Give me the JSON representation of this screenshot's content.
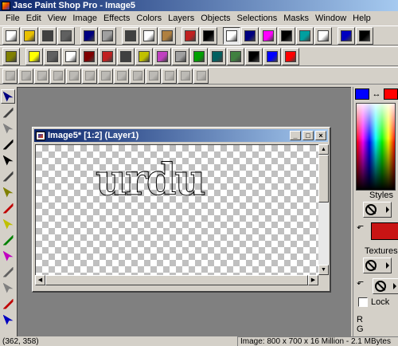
{
  "window": {
    "title": "Jasc Paint Shop Pro - Image5"
  },
  "menu": [
    "File",
    "Edit",
    "View",
    "Image",
    "Effects",
    "Colors",
    "Layers",
    "Objects",
    "Selections",
    "Masks",
    "Window",
    "Help"
  ],
  "toolbar1": [
    {
      "name": "new-icon",
      "color": "#ffffff"
    },
    {
      "name": "open-icon",
      "color": "#e8c000"
    },
    {
      "name": "save-icon",
      "color": "#404040"
    },
    {
      "name": "print-icon",
      "color": "#606060"
    },
    {
      "name": "undo-icon",
      "color": "#000080"
    },
    {
      "name": "redo-icon",
      "color": "#a0a0a0"
    },
    {
      "name": "cut-icon",
      "color": "#404040"
    },
    {
      "name": "copy-icon",
      "color": "#ffffff"
    },
    {
      "name": "paste-icon",
      "color": "#b08040"
    },
    {
      "name": "browse-icon",
      "color": "#c02020"
    },
    {
      "name": "cancel-icon",
      "color": "#000000"
    },
    {
      "name": "zoom-icon",
      "color": "#ffffff"
    },
    {
      "name": "overview-icon",
      "color": "#000080"
    },
    {
      "name": "color-palette-icon",
      "color": "#ff00ff"
    },
    {
      "name": "histogram-icon",
      "color": "#000000"
    },
    {
      "name": "layer-palette-icon",
      "color": "#00a0a0"
    },
    {
      "name": "window-icon",
      "color": "#ffffff"
    },
    {
      "name": "help-icon",
      "color": "#0000c0"
    },
    {
      "name": "context-help-icon",
      "color": "#000000"
    }
  ],
  "toolbar2": [
    {
      "name": "effect-browser-icon",
      "color": "#808000"
    },
    {
      "name": "buttonize-icon",
      "color": "#ffff00"
    },
    {
      "name": "chisel-icon",
      "color": "#606060"
    },
    {
      "name": "cutout-icon",
      "color": "#ffffff"
    },
    {
      "name": "drop-shadow-icon",
      "color": "#800000"
    },
    {
      "name": "hot-wax-icon",
      "color": "#c02020"
    },
    {
      "name": "inner-bevel-icon",
      "color": "#404040"
    },
    {
      "name": "outer-bevel-icon",
      "color": "#c0c000"
    },
    {
      "name": "sculpture-icon",
      "color": "#c040c0"
    },
    {
      "name": "emboss-icon",
      "color": "#a0a0a0"
    },
    {
      "name": "kaleidoscope-icon",
      "color": "#00a000"
    },
    {
      "name": "pattern-icon",
      "color": "#006060"
    },
    {
      "name": "texture-icon",
      "color": "#408040"
    },
    {
      "name": "tile-icon",
      "color": "#000000"
    },
    {
      "name": "twirl-icon",
      "color": "#0000ff"
    },
    {
      "name": "blinds-icon",
      "color": "#ff0000"
    }
  ],
  "toolbar3": [
    {
      "name": "new-raster-layer-icon"
    },
    {
      "name": "delete-layer-icon"
    },
    {
      "name": "duplicate-layer-icon"
    },
    {
      "name": "layer-properties-icon"
    },
    {
      "name": "new-vector-layer-icon"
    },
    {
      "name": "new-mask-icon"
    },
    {
      "name": "promote-layer-icon"
    },
    {
      "name": "merge-layer-icon"
    },
    {
      "name": "group-layer-icon"
    },
    {
      "name": "adjust-layer-icon"
    },
    {
      "name": "layer-visible-icon"
    },
    {
      "name": "layer-lock-icon"
    },
    {
      "name": "layer-opacity-icon"
    }
  ],
  "tools": [
    {
      "name": "arrow-tool-icon"
    },
    {
      "name": "zoom-tool-icon"
    },
    {
      "name": "deform-tool-icon"
    },
    {
      "name": "crop-tool-icon"
    },
    {
      "name": "move-tool-icon"
    },
    {
      "name": "selection-tool-icon"
    },
    {
      "name": "lasso-tool-icon"
    },
    {
      "name": "dropper-tool-icon"
    },
    {
      "name": "paintbrush-tool-icon"
    },
    {
      "name": "clone-brush-tool-icon"
    },
    {
      "name": "color-replacer-tool-icon"
    },
    {
      "name": "retouch-tool-icon"
    },
    {
      "name": "scratch-remover-tool-icon"
    },
    {
      "name": "eraser-tool-icon"
    },
    {
      "name": "picture-tube-tool-icon"
    }
  ],
  "document": {
    "caption": "Image5* [1:2] (Layer1)",
    "canvas_text": "urdu"
  },
  "colorpanel": {
    "foreground": "#0000ff",
    "background": "#ff0000",
    "swap": "↔",
    "styles_label": "Styles",
    "textures_label": "Textures",
    "lock_label": "Lock",
    "r_label": "R",
    "g_label": "G"
  },
  "status": {
    "coords": "(362, 358)",
    "image_info": "Image:  800 x 700 x 16 Million - 2.1 MBytes"
  }
}
